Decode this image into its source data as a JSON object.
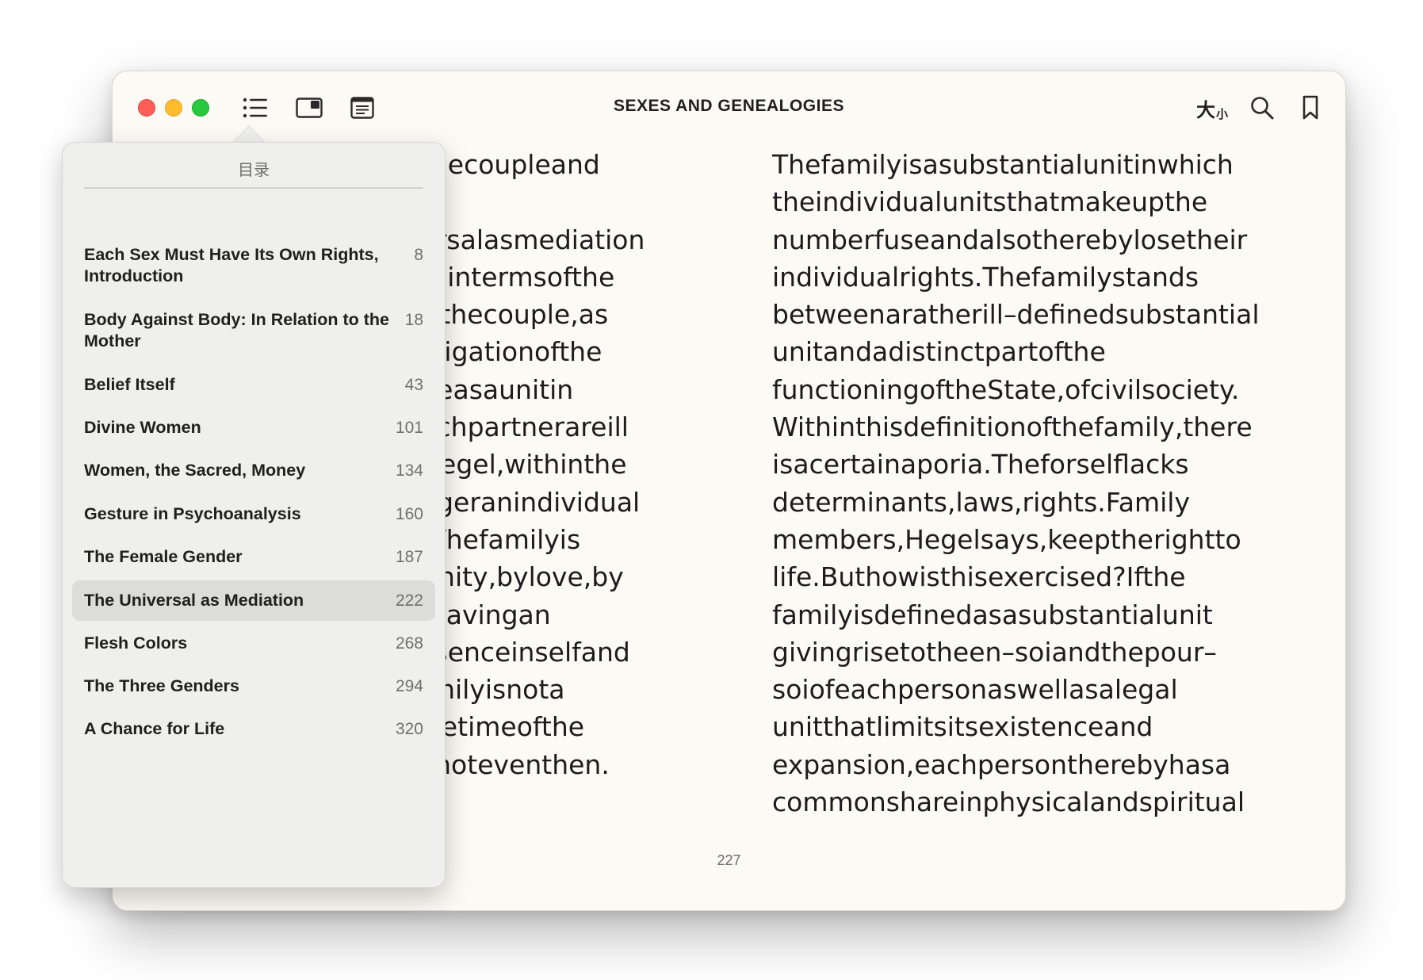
{
  "window": {
    "title": "SEXES AND GENEALOGIES"
  },
  "toolbar": {
    "left_icons": [
      "list-icon",
      "sidebar-toggle-icon",
      "reader-view-icon"
    ],
    "text_size_label_big": "大",
    "text_size_label_small": "小",
    "right_icons": [
      "search-icon",
      "bookmark-icon"
    ]
  },
  "toc": {
    "header": "目录",
    "items": [
      {
        "title": "Each Sex Must Have Its Own Rights, Introduction",
        "page": "8"
      },
      {
        "title": "Body Against Body: In Relation to the Mother",
        "page": "18"
      },
      {
        "title": "Belief Itself",
        "page": "43"
      },
      {
        "title": "Divine Women",
        "page": "101"
      },
      {
        "title": "Women, the Sacred, Money",
        "page": "134"
      },
      {
        "title": "Gesture in Psychoanalysis",
        "page": "160"
      },
      {
        "title": "The Female Gender",
        "page": "187"
      },
      {
        "title": "The Universal as Mediation",
        "page": "222"
      },
      {
        "title": "Flesh Colors",
        "page": "268"
      },
      {
        "title": "The Three Genders",
        "page": "294"
      },
      {
        "title": "A Chance for Life",
        "page": "320"
      }
    ],
    "selected_index": 7
  },
  "page": {
    "left_lines": [
      "n the couple and",
      "",
      "versal as mediation",
      "ted in terms of the",
      "for the couple, as",
      "estigation of the",
      "age as a unit in",
      "each partner are ill",
      "o Hegel, within the",
      "onger an individual",
      "i). The family is",
      "lt unity, by love, by",
      "of having an",
      "essence in self and",
      "family is not a",
      "t the time of the",
      "ps not even then."
    ],
    "right_lines": [
      "The family is a substantial unit in which",
      "the individual units that make up the",
      "number fuse and also thereby lose their",
      "individual rights. The family stands",
      "between a rather ill–defined substantial",
      "unit and a distinct part of the",
      "functioning of the State, of civil society.",
      "Within this definition of the family, there",
      "is a certain aporia. The for self lacks",
      "determinants, laws, rights. Family",
      "members, Hegel says, keep the right to",
      "life. But how is this exercised? If the",
      "family is defined as a substantial unit",
      "giving rise to the en–soi and the pour–",
      "soi of each person as well as a legal",
      "unit that limits its existence and",
      "expansion, each person thereby has a",
      "common share in physical and spiritual"
    ],
    "page_number": "227"
  }
}
